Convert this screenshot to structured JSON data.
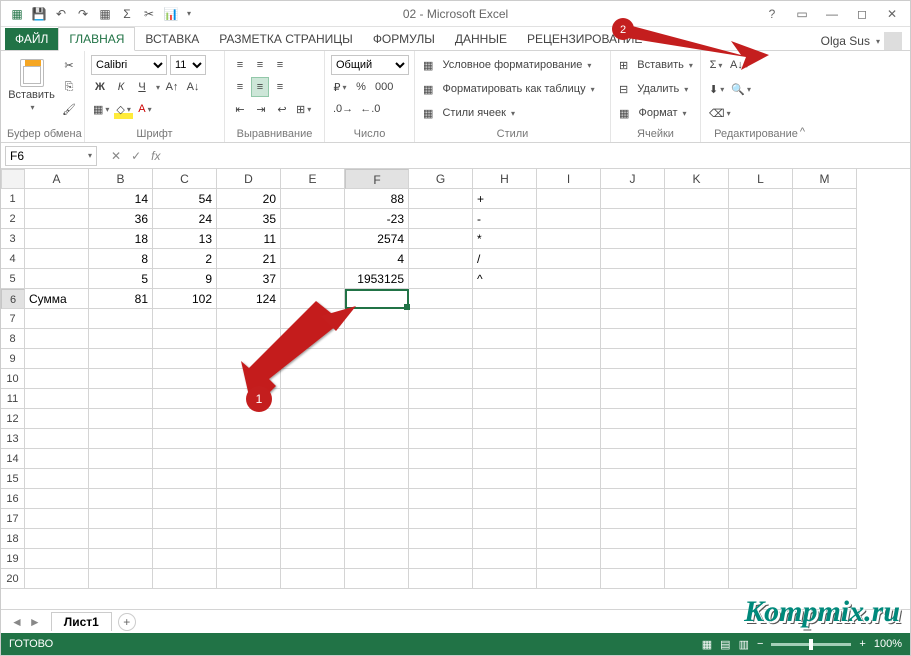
{
  "title": "02 - Microsoft Excel",
  "user": "Olga Sus",
  "tabs": {
    "file": "ФАЙЛ",
    "home": "ГЛАВНАЯ",
    "insert": "ВСТАВКА",
    "layout": "РАЗМЕТКА СТРАНИЦЫ",
    "formulas": "ФОРМУЛЫ",
    "data": "ДАННЫЕ",
    "review": "РЕЦЕНЗИРОВАНИЕ"
  },
  "groups": {
    "clipboard": "Буфер обмена",
    "font": "Шрифт",
    "align": "Выравнивание",
    "number": "Число",
    "styles": "Стили",
    "cells": "Ячейки",
    "editing": "Редактирование"
  },
  "clipboard": {
    "paste": "Вставить"
  },
  "font": {
    "name": "Calibri",
    "size": "11",
    "bold": "Ж",
    "italic": "К",
    "underline": "Ч"
  },
  "number": {
    "format": "Общий"
  },
  "styles": {
    "cond": "Условное форматирование",
    "table": "Форматировать как таблицу",
    "cell": "Стили ячеек"
  },
  "cells": {
    "insert": "Вставить",
    "delete": "Удалить",
    "format": "Формат"
  },
  "namebox": "F6",
  "status": {
    "ready": "ГОТОВО",
    "zoom": "100%"
  },
  "sheet": {
    "name": "Лист1"
  },
  "watermark": "Kompmix.ru",
  "callout": {
    "one": "1",
    "two": "2"
  },
  "columns": [
    "A",
    "B",
    "C",
    "D",
    "E",
    "F",
    "G",
    "H",
    "I",
    "J",
    "K",
    "L",
    "M"
  ],
  "rows": [
    {
      "n": "1",
      "A": "",
      "B": "14",
      "C": "54",
      "D": "20",
      "F": "88",
      "H": "+"
    },
    {
      "n": "2",
      "A": "",
      "B": "36",
      "C": "24",
      "D": "35",
      "F": "-23",
      "H": "-"
    },
    {
      "n": "3",
      "A": "",
      "B": "18",
      "C": "13",
      "D": "11",
      "F": "2574",
      "H": "*"
    },
    {
      "n": "4",
      "A": "",
      "B": "8",
      "C": "2",
      "D": "21",
      "F": "4",
      "H": "/"
    },
    {
      "n": "5",
      "A": "",
      "B": "5",
      "C": "9",
      "D": "37",
      "F": "1953125",
      "H": "^"
    },
    {
      "n": "6",
      "A": "Сумма",
      "B": "81",
      "C": "102",
      "D": "124",
      "F": "",
      "H": ""
    },
    {
      "n": "7"
    },
    {
      "n": "8"
    },
    {
      "n": "9"
    },
    {
      "n": "10"
    },
    {
      "n": "11"
    },
    {
      "n": "12"
    },
    {
      "n": "13"
    },
    {
      "n": "14"
    },
    {
      "n": "15"
    },
    {
      "n": "16"
    },
    {
      "n": "17"
    },
    {
      "n": "18"
    },
    {
      "n": "19"
    },
    {
      "n": "20"
    }
  ]
}
